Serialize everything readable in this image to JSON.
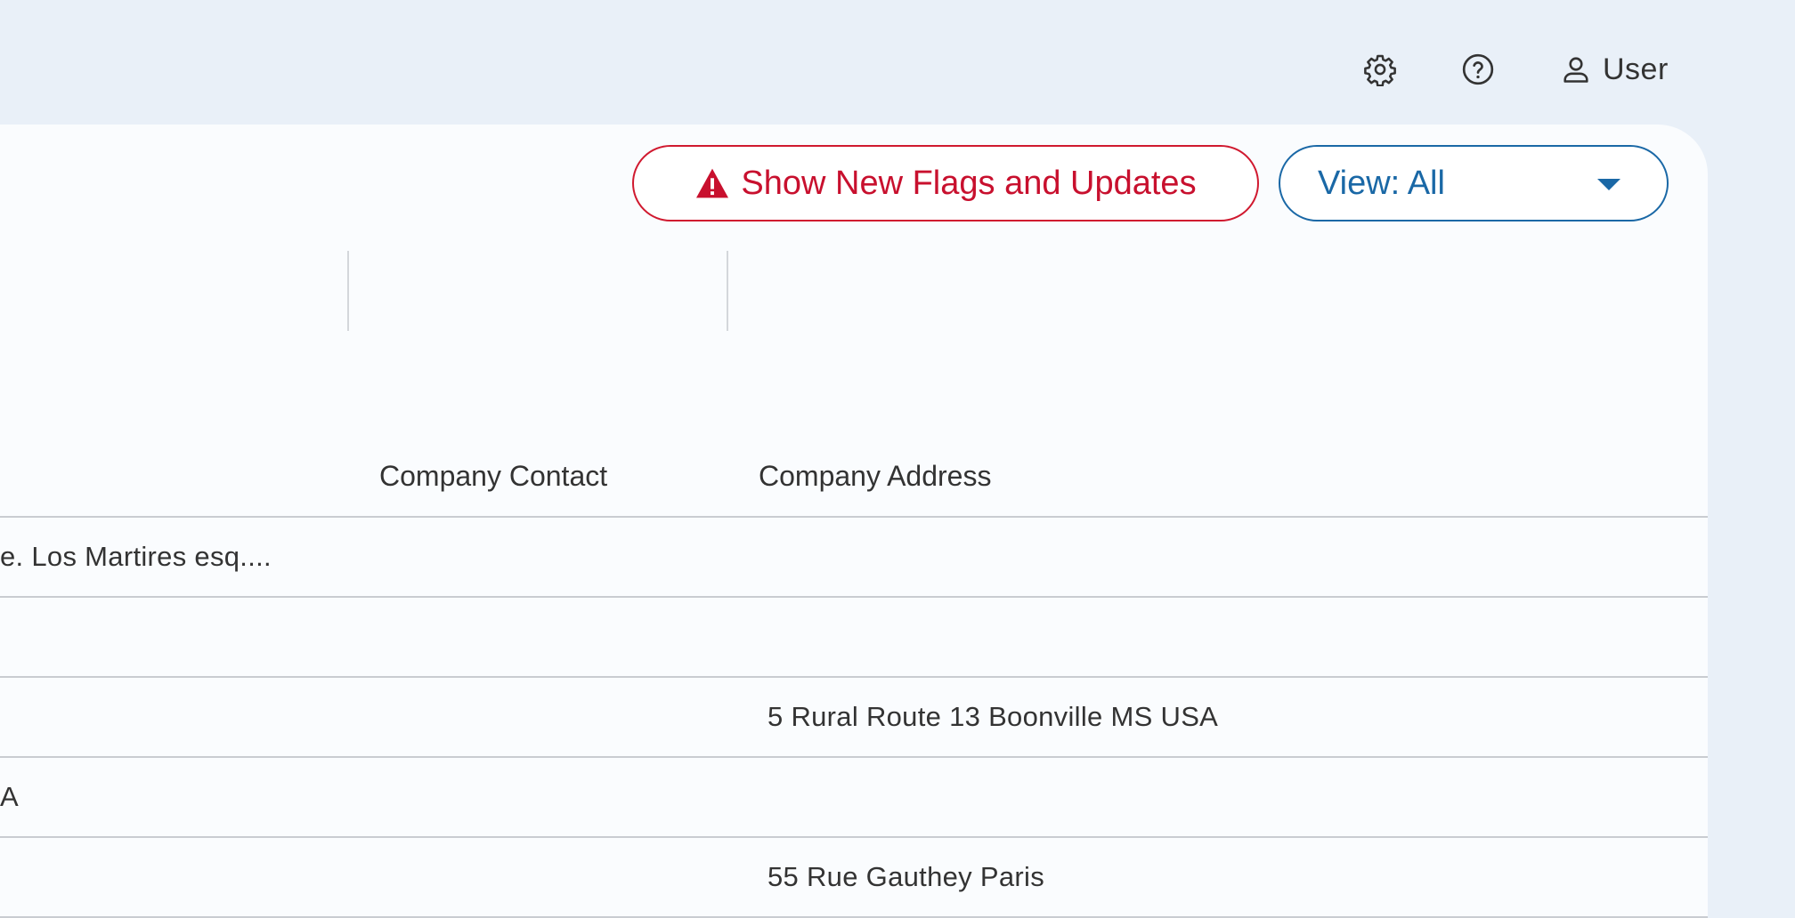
{
  "header": {
    "settings_icon": "gear-icon",
    "help_icon": "help-circle-icon",
    "user_icon": "person-icon",
    "user_label": "User"
  },
  "toolbar": {
    "flags_button_label": "Show New Flags and Updates",
    "flags_icon": "warning-triangle-icon",
    "view_select_label": "View: All",
    "view_caret_icon": "caret-down-icon"
  },
  "table": {
    "columns": [
      "Company Contact",
      "Company Address"
    ],
    "rows": [
      {
        "first_col": "e. Los Martires esq....",
        "address": ""
      },
      {
        "first_col": "",
        "address": ""
      },
      {
        "first_col": "",
        "address": "5 Rural Route 13 Boonville MS USA"
      },
      {
        "first_col": "A",
        "address": ""
      },
      {
        "first_col": "",
        "address": "55 Rue Gauthey Paris"
      }
    ]
  },
  "colors": {
    "background": "#e9f0f8",
    "panel": "#fafcfe",
    "alert": "#c8102e",
    "primary": "#1a68a6"
  }
}
